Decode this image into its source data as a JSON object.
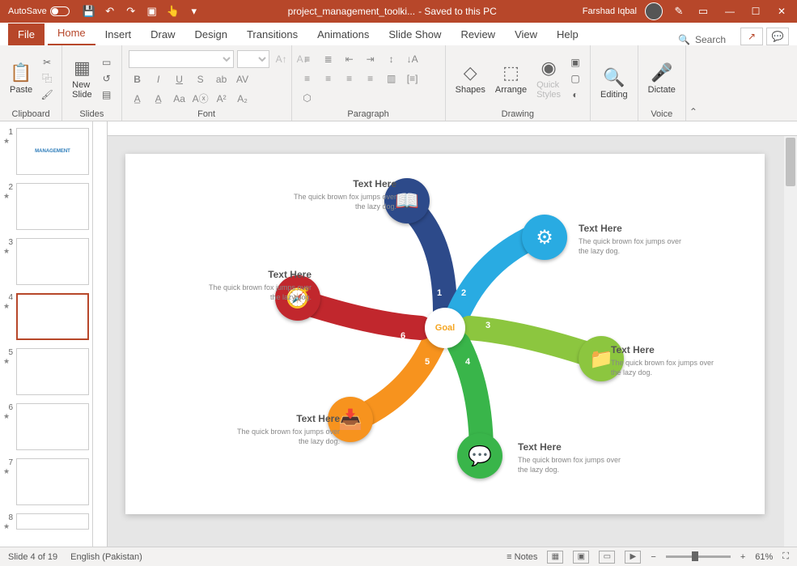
{
  "titlebar": {
    "autosave": "AutoSave",
    "filename": "project_management_toolki...",
    "saved": "- Saved to this PC",
    "user": "Farshad Iqbal"
  },
  "tabs": {
    "file": "File",
    "home": "Home",
    "insert": "Insert",
    "draw": "Draw",
    "design": "Design",
    "transitions": "Transitions",
    "animations": "Animations",
    "slideshow": "Slide Show",
    "review": "Review",
    "view": "View",
    "help": "Help",
    "search": "Search"
  },
  "ribbon": {
    "paste": "Paste",
    "clipboard": "Clipboard",
    "newslide": "New\nSlide",
    "slides": "Slides",
    "font": "Font",
    "paragraph": "Paragraph",
    "shapes": "Shapes",
    "arrange": "Arrange",
    "quickstyles": "Quick\nStyles",
    "drawing": "Drawing",
    "editing": "Editing",
    "dictate": "Dictate",
    "voice": "Voice"
  },
  "thumbs": [
    "1",
    "2",
    "3",
    "4",
    "5",
    "6",
    "7",
    "8"
  ],
  "slide": {
    "goal": "Goal",
    "items": [
      {
        "num": "1",
        "title": "Text Here",
        "body": "The quick brown fox jumps over the lazy dog."
      },
      {
        "num": "2",
        "title": "Text Here",
        "body": "The quick brown fox jumps over the lazy dog."
      },
      {
        "num": "3",
        "title": "Text Here",
        "body": "The quick brown fox jumps over the lazy dog."
      },
      {
        "num": "4",
        "title": "Text Here",
        "body": "The quick brown fox jumps over the lazy dog."
      },
      {
        "num": "5",
        "title": "Text Here",
        "body": "The quick brown fox jumps over the lazy dog."
      },
      {
        "num": "6",
        "title": "Text Here",
        "body": "The quick brown fox jumps over the lazy dog."
      }
    ]
  },
  "status": {
    "slide": "Slide 4 of 19",
    "lang": "English (Pakistan)",
    "notes": "Notes",
    "zoom": "61%"
  }
}
